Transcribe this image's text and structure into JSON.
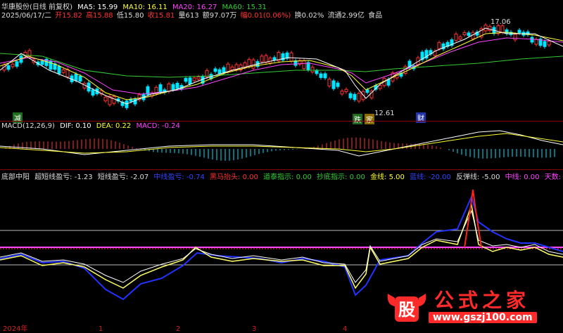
{
  "header": {
    "title": "华康股份(日线 前复权)",
    "ma5": "MA5: 15.99",
    "ma10": "MA10: 16.11",
    "ma20": "MA20: 16.27",
    "ma60": "MA60: 15.31",
    "date": "2025/06/17/二",
    "open": "开15.82",
    "high": "高15.88",
    "low": "低15.80",
    "close": "收15.81",
    "volume": "量613",
    "amount": "额97.07万",
    "change": "幅0.01(0.06%)",
    "turnover": "换0.02%",
    "float": "流通2.99亿",
    "sector": "食品"
  },
  "price_annotations": {
    "high_mark": "17.06",
    "low_mark": "12.61",
    "badge_jian": "减",
    "badge_die": "跌",
    "badge_jia": "家",
    "badge_cai": "财"
  },
  "macd": {
    "label": "MACD(12,26,9)",
    "dif": "DIF: 0.10",
    "dea": "DEA: 0.22",
    "macd": "MACD: -0.24"
  },
  "indicator": {
    "name": "底部中阳",
    "ultra_short": "超短线盈亏: -1.23",
    "short": "短线盈亏: -2.07",
    "mid": "中线盈亏: -0.74",
    "heima": "黑马抬头: 0.00",
    "daotai": "道泰指示: 0.00",
    "chaodi": "抄底指示: 0.00",
    "jinxian": "金线: 5.00",
    "lanxian": "蓝线: -20.00",
    "fantan": "反弹线: -5.00",
    "zhongxian": "中线: 0.00",
    "tianshu": "天数: 0.00"
  },
  "axis": {
    "year": "2024年",
    "m1": "1",
    "m2": "2",
    "m3": "3",
    "m4": "4"
  },
  "watermark": {
    "text": "公式之家",
    "url": "www.gszj100.com",
    "logo_char": "股"
  },
  "colors": {
    "up": "#ff3333",
    "down": "#00e5ff",
    "ma5": "#ffffff",
    "ma10": "#ffff33",
    "ma20": "#ff44ff",
    "ma60": "#33cc33",
    "blue": "#2233ff"
  }
}
